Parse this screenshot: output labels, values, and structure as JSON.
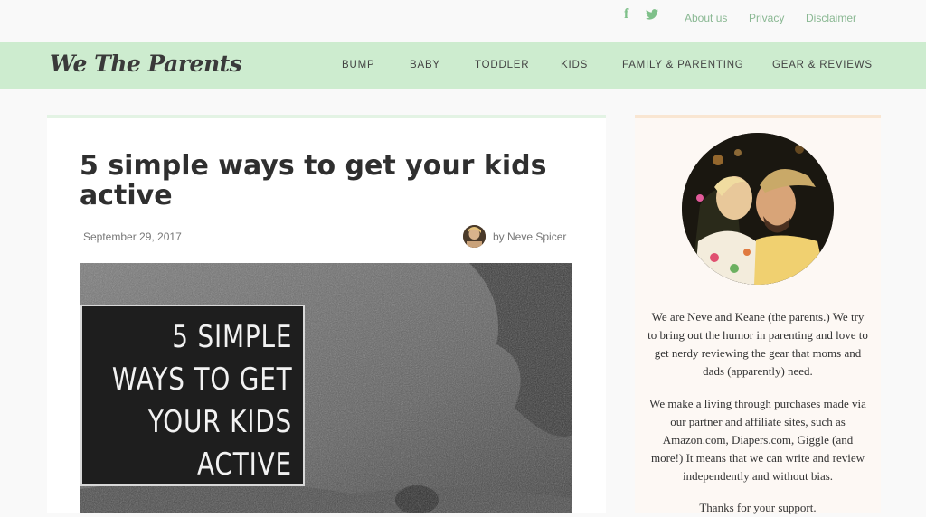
{
  "topbar": {
    "social": {
      "facebook": "f",
      "twitter_icon": "twitter-icon"
    },
    "links": [
      "About us",
      "Privacy",
      "Disclaimer"
    ]
  },
  "nav": {
    "logo": "We The Parents",
    "items": [
      "BUMP",
      "BABY",
      "TODDLER",
      "KIDS",
      "FAMILY & PARENTING",
      "GEAR & REVIEWS"
    ]
  },
  "article": {
    "title": "5 simple ways to get your kids active",
    "date": "September 29, 2017",
    "byline": "by Neve Spicer",
    "hero_lines": [
      "5 SIMPLE",
      "WAYS TO GET",
      "YOUR KIDS",
      "ACTIVE"
    ]
  },
  "sidebar": {
    "paragraphs": [
      "We are Neve and Keane (the parents.) We try to bring out the humor in parenting and love to get nerdy reviewing the gear that moms and dads (apparently) need.",
      "We make a living through purchases made via our partner and affiliate sites, such as Amazon.com, Diapers.com, Giggle (and more!) It means that we can write and review independently and without bias.",
      "Thanks for your support."
    ]
  },
  "colors": {
    "nav_bg": "#cdeccf",
    "accent_green": "#7fc08a",
    "sidebar_bg": "#fdf8f4",
    "sidebar_border": "#f9e6d2"
  }
}
